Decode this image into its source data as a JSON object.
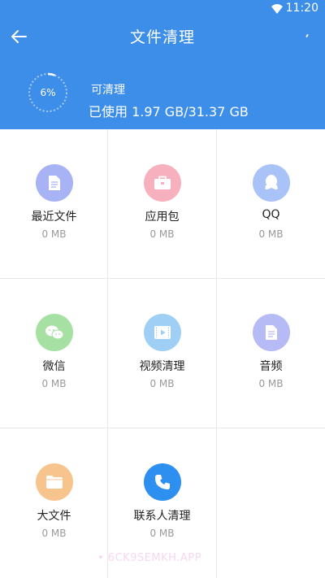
{
  "status": {
    "time": "11:20"
  },
  "toolbar": {
    "title": "文件清理"
  },
  "storage": {
    "percent_label": "6%",
    "percent_value": 0.06,
    "clean_label": "可清理",
    "used_label": "已使用 1.97 GB/31.37 GB"
  },
  "categories": [
    {
      "name": "最近文件",
      "size": "0 MB",
      "color": "#a8b3f5",
      "icon": "document-icon"
    },
    {
      "name": "应用包",
      "size": "0 MB",
      "color": "#f7b0bd",
      "icon": "briefcase-icon"
    },
    {
      "name": "QQ",
      "size": "0 MB",
      "color": "#a9c2f7",
      "icon": "qq-penguin-icon"
    },
    {
      "name": "微信",
      "size": "0 MB",
      "color": "#a6e0a3",
      "icon": "wechat-icon"
    },
    {
      "name": "视频清理",
      "size": "0 MB",
      "color": "#9fcff5",
      "icon": "video-icon"
    },
    {
      "name": "音频",
      "size": "0 MB",
      "color": "#b6baf5",
      "icon": "audio-document-icon"
    },
    {
      "name": "大文件",
      "size": "0 MB",
      "color": "#f7c48e",
      "icon": "folder-icon"
    },
    {
      "name": "联系人清理",
      "size": "0 MB",
      "color": "#2d8ff0",
      "icon": "phone-icon"
    }
  ],
  "watermark": "• 6CK9SEMKH.APP"
}
